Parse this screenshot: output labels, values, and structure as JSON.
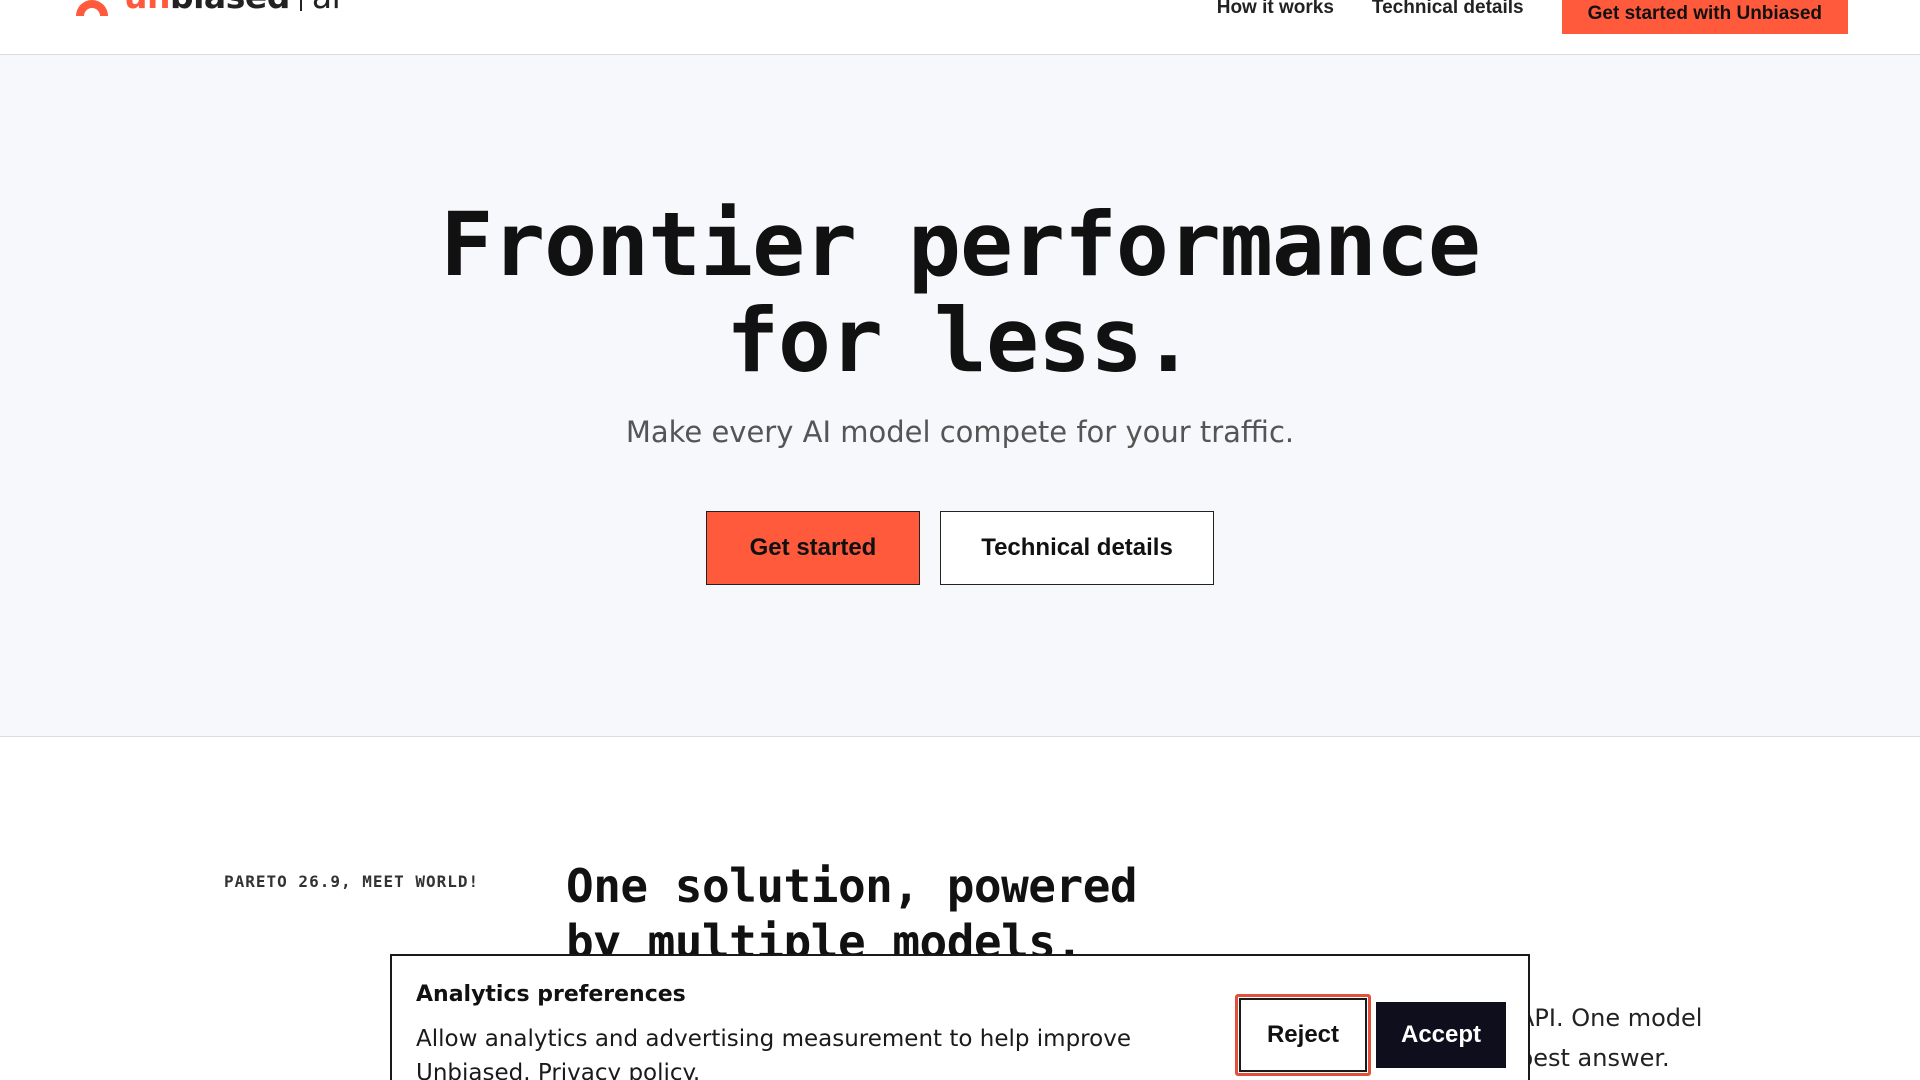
{
  "header": {
    "logo": {
      "un": "un",
      "biased": "biased",
      "ai": "ai"
    },
    "nav": {
      "how_it_works": "How it works",
      "technical_details": "Technical details",
      "cta": "Get started with Unbiased"
    }
  },
  "hero": {
    "title_line1": "Frontier performance",
    "title_line2": "for less.",
    "subtitle": "Make every AI model compete for your traffic.",
    "primary_button": "Get started",
    "secondary_button": "Technical details"
  },
  "section": {
    "eyebrow": "PARETO 26.9, MEET WORLD!",
    "title_line1": "One solution, powered",
    "title_line2": "by multiple models.",
    "side_line1": "API. One model",
    "side_line2": "best answer."
  },
  "consent": {
    "title": "Analytics preferences",
    "text": "Allow analytics and advertising measurement to help improve Unbiased.",
    "privacy_link": "Privacy policy.",
    "reject": "Reject",
    "accept": "Accept"
  },
  "colors": {
    "brand": "#ff5a3c",
    "hero_bg": "#f7f8fc",
    "accept_bg": "#0e0e1c",
    "focus_ring": "#e0503a"
  },
  "icons": {
    "logo": "unbiased-arch-logo"
  }
}
